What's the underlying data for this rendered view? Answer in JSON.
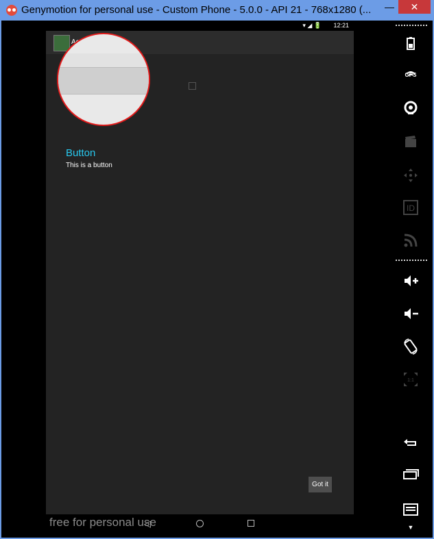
{
  "window": {
    "title": "Genymotion for personal use - Custom Phone - 5.0.0 - API 21 - 768x1280 (...",
    "minimize_label": "—",
    "close_label": "✕"
  },
  "statusbar": {
    "icons": "▾ ◢ 🔋",
    "time": "12:21"
  },
  "app": {
    "action_title": "Activity",
    "button_title": "Button",
    "button_description": "This is a button",
    "gotit_label": "Got it"
  },
  "watermark": "free for personal use",
  "nav": {
    "back": "◁"
  },
  "sidebar": {
    "gps_label": "GPS",
    "id_label": "ID",
    "scale_label": "1:1",
    "icons": [
      "battery-icon",
      "gps-icon",
      "camera-icon",
      "video-icon",
      "dpad-icon",
      "id-icon",
      "rss-icon",
      "volume-up-icon",
      "volume-down-icon",
      "rotate-icon",
      "scale-icon",
      "back-icon",
      "recent-apps-icon",
      "menu-icon"
    ]
  },
  "colors": {
    "titlebar": "#6c9ce6",
    "close": "#c7383a",
    "accent": "#28c8ee",
    "magnifier_border": "#e41b1b"
  }
}
